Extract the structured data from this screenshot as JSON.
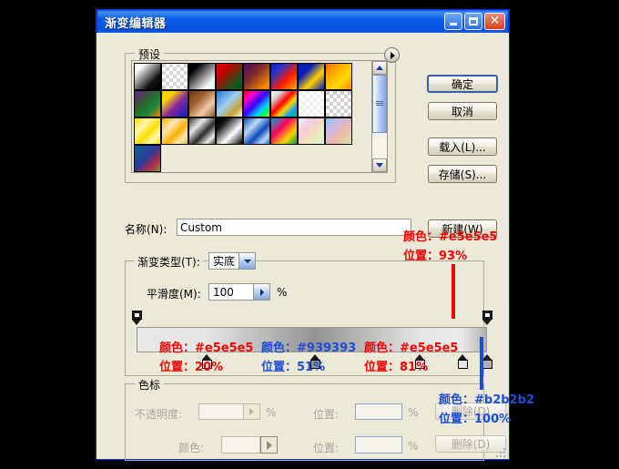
{
  "window": {
    "title": "渐变编辑器",
    "buttons": {
      "minimize": "minimize-icon",
      "maximize": "maximize-icon",
      "close": "close-icon"
    }
  },
  "preset": {
    "group_label": "预设",
    "menu_icon": "preset-menu-arrow-icon",
    "swatches": [
      "linear-gradient(135deg,#ffffff 0%,#ffffff 18%,#101010 72%,#000000 100%)",
      "repeating-conic-gradient(#ffffff 0% 25%, #d8d8d8 0% 50%)",
      "linear-gradient(135deg,#000000 0%,#000000 20%,#f6f6f6 78%,#ffffff 100%)",
      "linear-gradient(135deg,#e00000 0%,#c40000 28%,#0f5c1e 80%,#0b4a18 100%)",
      "linear-gradient(135deg,#4a0a6e 0%,#7a2a2a 40%,#ff8a00 88%,#ff7a00 100%)",
      "linear-gradient(135deg,#0b22c8 0%,#2a32d0 25%,#ff1a00 62%,#ffb300 100%)",
      "linear-gradient(135deg,#0a1fb8 0%,#0a1fb8 30%,#ffd200 62%,#0a1fb8 100%)",
      "linear-gradient(135deg,#ff6a00 0%,#ffb000 35%,#ffd800 65%,#ff8a00 100%)",
      "linear-gradient(135deg,#6a1a7a 0%,#2a6a2a 45%,#1b8a3a 70%,#ff7a00 100%)",
      "linear-gradient(135deg,#ffd200 0%,#ffd200 25%,#8a2a9a 55%,#0a1fb8 100%)",
      "linear-gradient(135deg,#6a3a10 0%,#a06030 35%,#f0c8a8 68%,#8a5a2a 100%)",
      "linear-gradient(135deg,#1a7ad8 0%,#9fd0f2 45%,#c8a030 75%,#ffffff 100%)",
      "linear-gradient(135deg,#ff0000 0%,#ff00c8 22%,#3a00ff 48%,#00c8ff 70%,#00ff3a 88%,#ffd200 100%)",
      "linear-gradient(135deg,#ffffff 0%,#d8d8d8 20%,#ff0000 45%,#ffd200 62%,#00a0ff 82%,#00c050 100%)",
      "repeating-conic-gradient(#ffffff 0% 25%, #f0f0f0 0% 50%)",
      "repeating-conic-gradient(#ffffff 0% 25%, #cfcfcf 0% 50%)",
      "linear-gradient(135deg,#ffe000 0%,#fff6b0 30%,#ffe000 55%,#fff6b0 78%,#ffe000 100%)",
      "linear-gradient(135deg,#ffb000 0%,#ffe7b8 32%,#ffb000 58%,#ffe7b8 80%,#ffb000 100%)",
      "linear-gradient(135deg,#3a3a3a 0%,#e8e8e8 30%,#2a2a2a 58%,#e8e8e8 82%,#4a4a4a 100%)",
      "linear-gradient(135deg,#000000 0%,#111111 22%,#ffffff 62%,#000000 100%)",
      "linear-gradient(135deg,#0a4ab8 0%,#bcd8f8 32%,#0a4ab8 60%,#bcd8f8 82%,#1a6ad8 100%)",
      "linear-gradient(135deg,#00a8e8 0%,#ff0060 38%,#ffd200 70%,#00a84a 100%)",
      "linear-gradient(135deg,#eaf2ff 0%,#f6c8d8 35%,#f0e8b8 65%,#d8f0e0 100%)",
      "linear-gradient(135deg,#7ac8f0 0%,#c8b8e8 30%,#f0b8a8 60%,#d8e8a8 100%)",
      "linear-gradient(135deg,#0a6a8a 0%,#2a3a9a 45%,#b02a4a 75%,#7a9a2a 100%)"
    ],
    "scroll_up_icon": "scroll-up-arrow-icon",
    "scroll_down_icon": "scroll-down-arrow-icon"
  },
  "actions": {
    "ok": "确定",
    "cancel": "取消",
    "load": "载入(L)...",
    "save": "存储(S)...",
    "new": "新建(W)"
  },
  "name_row": {
    "label": "名称(N):",
    "value": "Custom"
  },
  "gradient_settings": {
    "type_label": "渐变类型(T):",
    "type_value": "实底",
    "smoothness_label": "平滑度(M):",
    "smoothness_value": "100",
    "percent_sign": "%"
  },
  "stops_group": {
    "label": "色标",
    "opacity_label": "不透明度:",
    "opacity_value": "",
    "opacity_percent": "%",
    "position1_label": "位置:",
    "position1_value": "",
    "position1_percent": "%",
    "delete1": "删除(D)",
    "color_label": "颜色:",
    "color_value": "",
    "position2_label": "位置:",
    "position2_value": "",
    "position2_percent": "%",
    "delete2": "删除(D)"
  },
  "gradient_bar": {
    "css": "linear-gradient(to right,#e8e8e8 0%,#e5e5e5 20%,#939393 51%,#e5e5e5 81%,#eaeaea 93%,#b2b2b2 100%)",
    "opacity_stops": [
      {
        "position": 0,
        "value": 100
      },
      {
        "position": 100,
        "value": 100
      }
    ],
    "color_stops": [
      {
        "position": 20,
        "color": "#e5e5e5"
      },
      {
        "position": 51,
        "color": "#939393"
      },
      {
        "position": 81,
        "color": "#e5e5e5"
      },
      {
        "position": 93,
        "color": "#e5e5e5"
      },
      {
        "position": 100,
        "color": "#b2b2b2"
      }
    ]
  },
  "annotations": [
    {
      "id": "a1",
      "color_text": "颜色：#e5e5e5",
      "position_text": "位置：93%",
      "color": "#ff0000"
    },
    {
      "id": "a2",
      "color_text": "颜色：#e5e5e5",
      "position_text": "位置：20%",
      "color": "#ff0000"
    },
    {
      "id": "a3",
      "color_text": "颜色：#939393",
      "position_text": "位置：51%",
      "color": "#1a4fd6"
    },
    {
      "id": "a4",
      "color_text": "颜色：#e5e5e5",
      "position_text": "位置：81%",
      "color": "#ff0000"
    },
    {
      "id": "a5",
      "color_text": "颜色：#b2b2b2",
      "position_text": "位置：100%",
      "color": "#1a4fd6"
    }
  ]
}
